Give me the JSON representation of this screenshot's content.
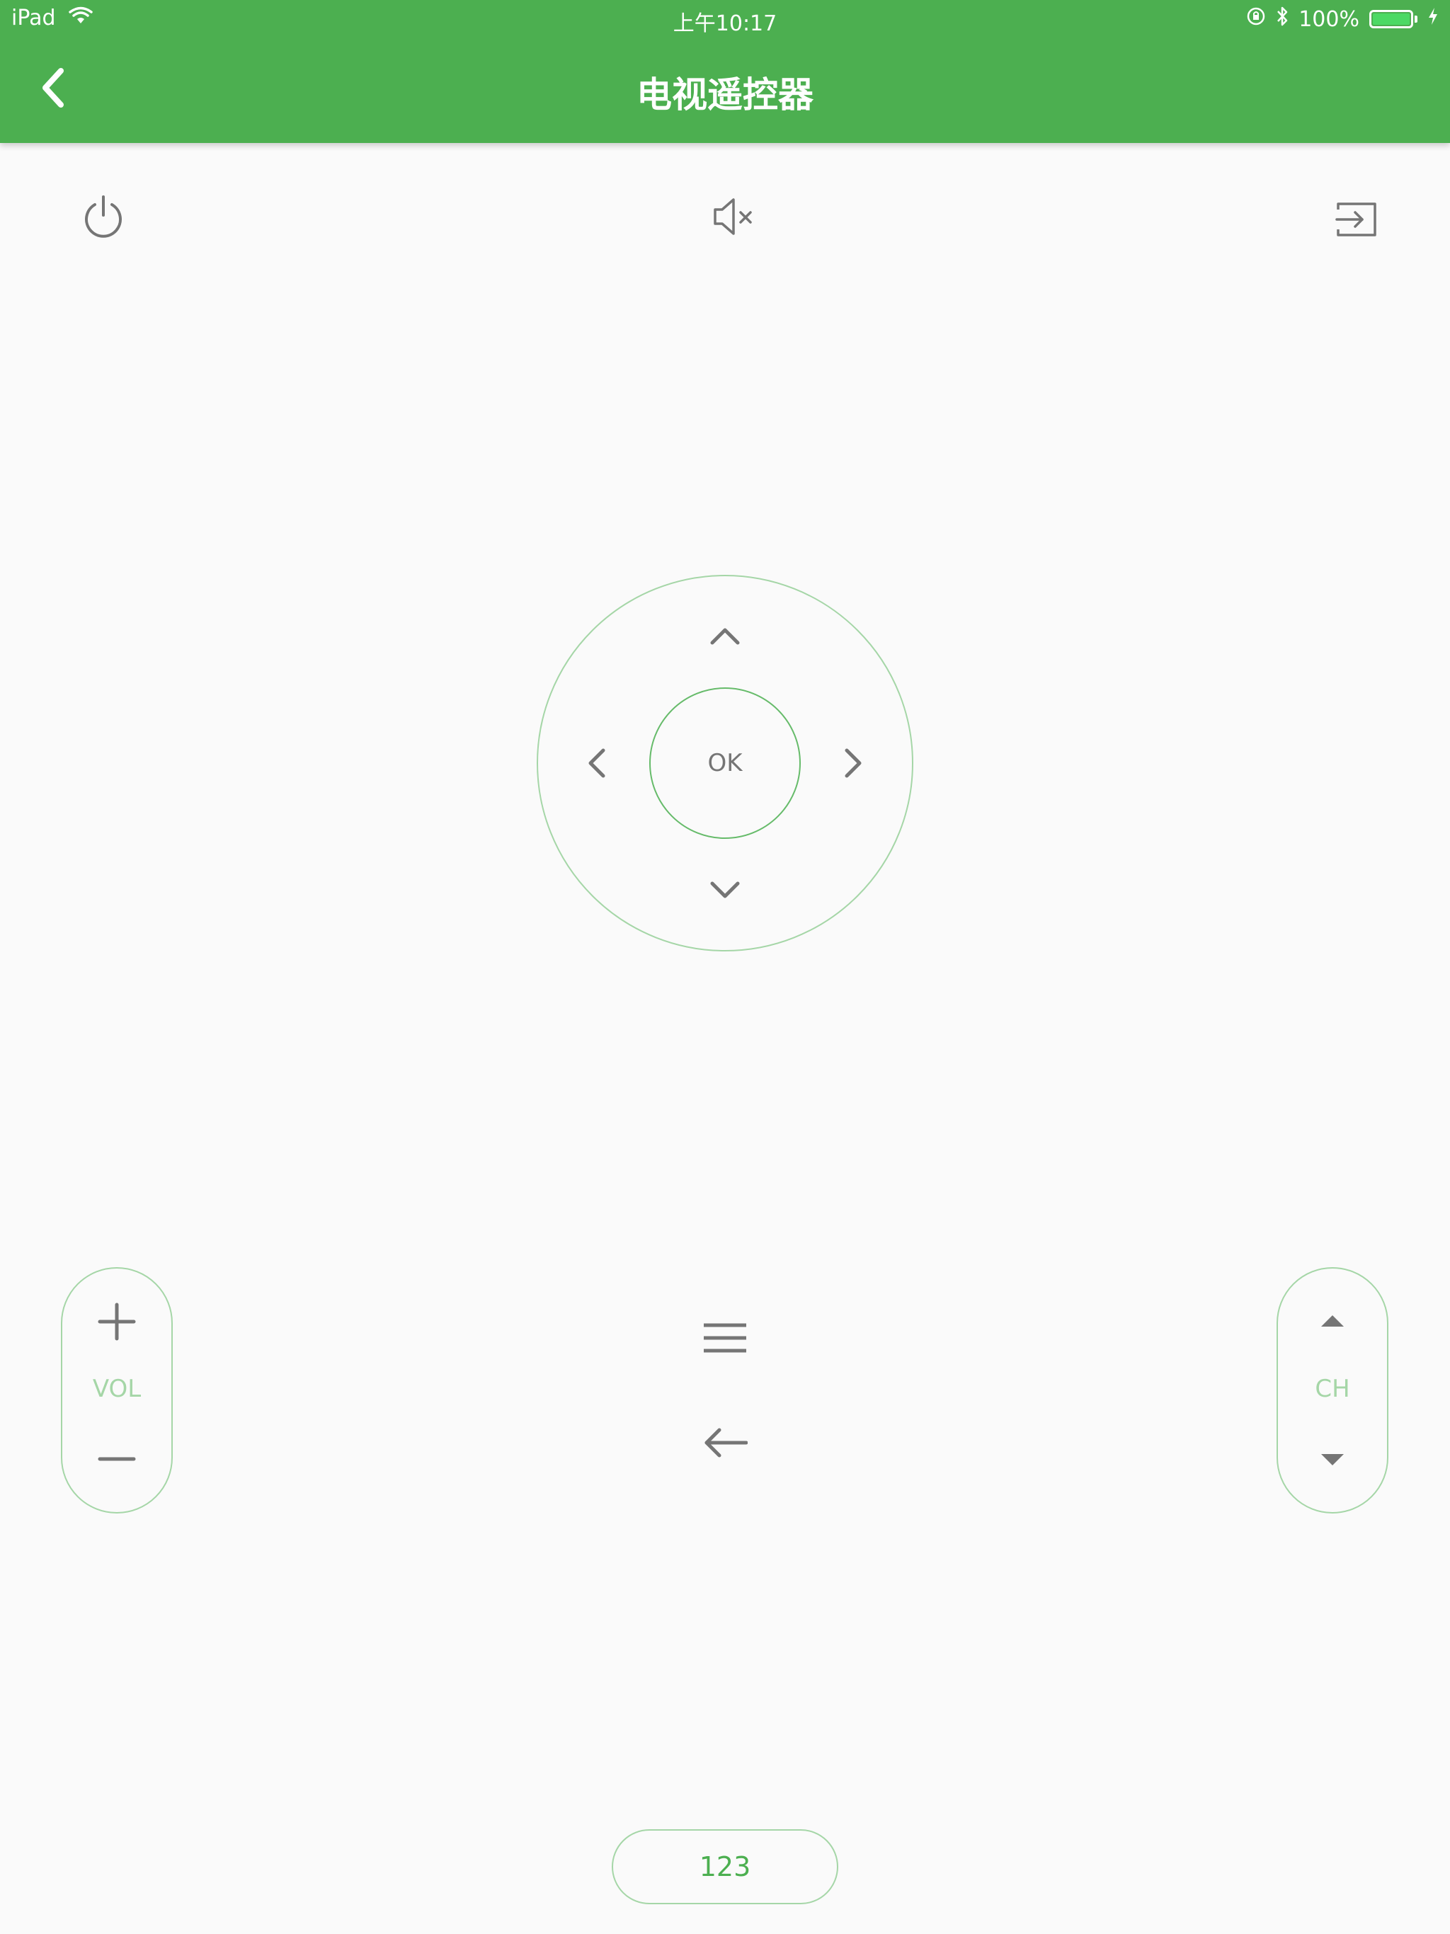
{
  "status_bar": {
    "device": "iPad",
    "time": "上午10:17",
    "battery": "100%",
    "battery_level": 1.0
  },
  "header": {
    "title": "电视遥控器"
  },
  "dpad": {
    "ok_label": "OK"
  },
  "volume": {
    "label": "VOL"
  },
  "channel": {
    "label": "CH"
  },
  "number_pad": {
    "label": "123"
  },
  "colors": {
    "primary": "#4caf50",
    "light_green": "#a5d6a7",
    "icon_gray": "#757575",
    "background": "#fafafa"
  },
  "icons": {
    "power": "power-icon",
    "mute": "mute-icon",
    "input": "input-source-icon",
    "menu": "menu-icon",
    "return": "return-arrow-icon"
  }
}
